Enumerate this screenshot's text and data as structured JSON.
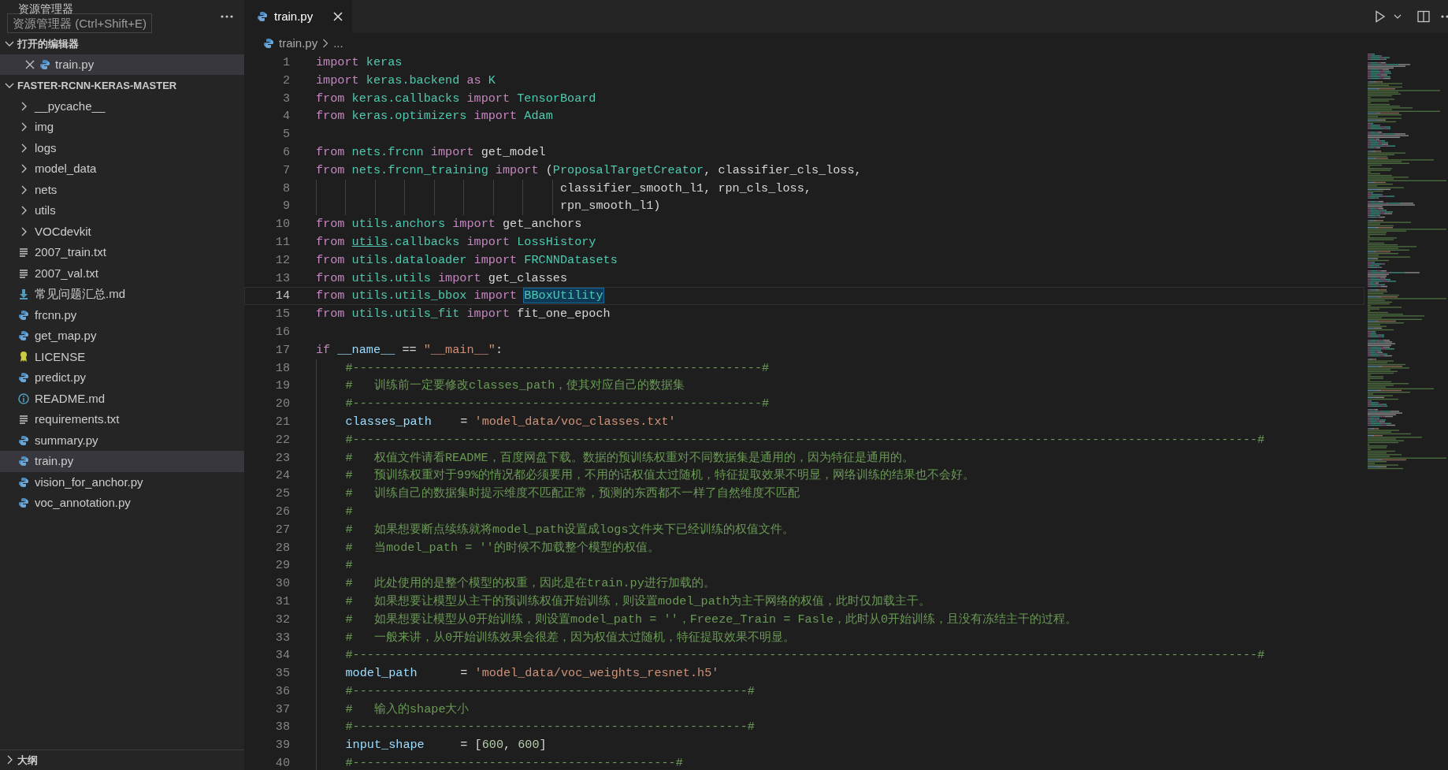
{
  "sidebar": {
    "title": "资源管理器",
    "tooltip": "资源管理器 (Ctrl+Shift+E)",
    "open_editors": {
      "label": "打开的编辑器",
      "expanded": true,
      "items": [
        {
          "name": "train.py",
          "kind": "python",
          "selected": true
        }
      ]
    },
    "project": {
      "label": "FASTER-RCNN-KERAS-MASTER",
      "expanded": true,
      "items": [
        {
          "name": "__pycache__",
          "kind": "folder",
          "selected": false
        },
        {
          "name": "img",
          "kind": "folder",
          "selected": false
        },
        {
          "name": "logs",
          "kind": "folder",
          "selected": false
        },
        {
          "name": "model_data",
          "kind": "folder",
          "selected": false
        },
        {
          "name": "nets",
          "kind": "folder",
          "selected": false
        },
        {
          "name": "utils",
          "kind": "folder",
          "selected": false
        },
        {
          "name": "VOCdevkit",
          "kind": "folder",
          "selected": false
        },
        {
          "name": "2007_train.txt",
          "kind": "text",
          "selected": false
        },
        {
          "name": "2007_val.txt",
          "kind": "text",
          "selected": false
        },
        {
          "name": "常见问题汇总.md",
          "kind": "markdown",
          "selected": false
        },
        {
          "name": "frcnn.py",
          "kind": "python",
          "selected": false
        },
        {
          "name": "get_map.py",
          "kind": "python",
          "selected": false
        },
        {
          "name": "LICENSE",
          "kind": "license",
          "selected": false
        },
        {
          "name": "predict.py",
          "kind": "python",
          "selected": false
        },
        {
          "name": "README.md",
          "kind": "info",
          "selected": false
        },
        {
          "name": "requirements.txt",
          "kind": "text",
          "selected": false
        },
        {
          "name": "summary.py",
          "kind": "python",
          "selected": false
        },
        {
          "name": "train.py",
          "kind": "python",
          "selected": true
        },
        {
          "name": "vision_for_anchor.py",
          "kind": "python",
          "selected": false
        },
        {
          "name": "voc_annotation.py",
          "kind": "python",
          "selected": false
        }
      ]
    },
    "outline": {
      "label": "大纲",
      "expanded": false
    }
  },
  "tabs": [
    {
      "label": "train.py",
      "kind": "python",
      "selected": true
    }
  ],
  "breadcrumb": [
    "train.py",
    "..."
  ],
  "editor": {
    "lines": [
      {
        "no": "1",
        "current": false,
        "tokens": [
          {
            "kind": "kw",
            "text": "import "
          },
          {
            "kind": "mod",
            "text": "keras"
          }
        ]
      },
      {
        "no": "2",
        "current": false,
        "tokens": [
          {
            "kind": "kw",
            "text": "import "
          },
          {
            "kind": "mod",
            "text": "keras.backend "
          },
          {
            "kind": "kw",
            "text": "as "
          },
          {
            "kind": "mod",
            "text": "K"
          }
        ]
      },
      {
        "no": "3",
        "current": false,
        "tokens": [
          {
            "kind": "kw",
            "text": "from "
          },
          {
            "kind": "mod",
            "text": "keras.callbacks "
          },
          {
            "kind": "kw",
            "text": "import "
          },
          {
            "kind": "mod",
            "text": "TensorBoard"
          }
        ]
      },
      {
        "no": "4",
        "current": false,
        "tokens": [
          {
            "kind": "kw",
            "text": "from "
          },
          {
            "kind": "mod",
            "text": "keras.optimizers "
          },
          {
            "kind": "kw",
            "text": "import "
          },
          {
            "kind": "mod",
            "text": "Adam"
          }
        ]
      },
      {
        "no": "5",
        "current": false
      },
      {
        "no": "6",
        "current": false,
        "tokens": [
          {
            "kind": "kw",
            "text": "from "
          },
          {
            "kind": "mod",
            "text": "nets.frcnn "
          },
          {
            "kind": "kw",
            "text": "import "
          },
          {
            "kind": "plain",
            "text": "get_model"
          }
        ]
      },
      {
        "no": "7",
        "current": false,
        "tokens": [
          {
            "kind": "kw",
            "text": "from "
          },
          {
            "kind": "mod",
            "text": "nets.frcnn_training "
          },
          {
            "kind": "kw",
            "text": "import "
          },
          {
            "kind": "plain",
            "text": "("
          },
          {
            "kind": "mod",
            "text": "ProposalTargetCreator"
          },
          {
            "kind": "plain",
            "text": ", classifier_cls_loss,"
          }
        ]
      },
      {
        "no": "8",
        "current": false,
        "tokens": [
          {
            "kind": "plain",
            "text": "                                 classifier_smooth_l1, rpn_cls_loss,"
          }
        ]
      },
      {
        "no": "9",
        "current": false,
        "tokens": [
          {
            "kind": "plain",
            "text": "                                 rpn_smooth_l1)"
          }
        ]
      },
      {
        "no": "10",
        "current": false,
        "tokens": [
          {
            "kind": "kw",
            "text": "from "
          },
          {
            "kind": "mod",
            "text": "utils.anchors "
          },
          {
            "kind": "kw",
            "text": "import "
          },
          {
            "kind": "plain",
            "text": "get_anchors"
          }
        ]
      },
      {
        "no": "11",
        "current": false,
        "tokens": [
          {
            "kind": "kw",
            "text": "from "
          },
          {
            "kind": "mod",
            "text": "utils",
            "underlined": true
          },
          {
            "kind": "mod",
            "text": ".callbacks "
          },
          {
            "kind": "kw",
            "text": "import "
          },
          {
            "kind": "mod",
            "text": "LossHistory"
          }
        ]
      },
      {
        "no": "12",
        "current": false,
        "tokens": [
          {
            "kind": "kw",
            "text": "from "
          },
          {
            "kind": "mod",
            "text": "utils.dataloader "
          },
          {
            "kind": "kw",
            "text": "import "
          },
          {
            "kind": "mod",
            "text": "FRCNNDatasets"
          }
        ]
      },
      {
        "no": "13",
        "current": false,
        "tokens": [
          {
            "kind": "kw",
            "text": "from "
          },
          {
            "kind": "mod",
            "text": "utils.utils "
          },
          {
            "kind": "kw",
            "text": "import "
          },
          {
            "kind": "plain",
            "text": "get_classes"
          }
        ]
      },
      {
        "no": "14",
        "current": true,
        "tokens": [
          {
            "kind": "kw",
            "text": "from "
          },
          {
            "kind": "mod",
            "text": "utils.utils_bbox "
          },
          {
            "kind": "kw",
            "text": "import "
          },
          {
            "kind": "mod",
            "text": "BBoxUtility",
            "highlighted": true
          }
        ]
      },
      {
        "no": "15",
        "current": false,
        "tokens": [
          {
            "kind": "kw",
            "text": "from "
          },
          {
            "kind": "mod",
            "text": "utils.utils_fit "
          },
          {
            "kind": "kw",
            "text": "import "
          },
          {
            "kind": "plain",
            "text": "fit_one_epoch"
          }
        ]
      },
      {
        "no": "16",
        "current": false
      },
      {
        "no": "17",
        "current": false,
        "tokens": [
          {
            "kind": "kw",
            "text": "if "
          },
          {
            "kind": "var",
            "text": "__name__"
          },
          {
            "kind": "plain",
            "text": " == "
          },
          {
            "kind": "str",
            "text": "\"__main__\""
          },
          {
            "kind": "plain",
            "text": ":"
          }
        ]
      },
      {
        "no": "18",
        "current": false,
        "tokens": [
          {
            "kind": "cmt",
            "text": "    #---------------------------------------------------------#"
          }
        ]
      },
      {
        "no": "19",
        "current": false,
        "tokens": [
          {
            "kind": "cmt",
            "text": "    #   训练前一定要修改classes_path，使其对应自己的数据集"
          }
        ]
      },
      {
        "no": "20",
        "current": false,
        "tokens": [
          {
            "kind": "cmt",
            "text": "    #---------------------------------------------------------#"
          }
        ]
      },
      {
        "no": "21",
        "current": false,
        "tokens": [
          {
            "kind": "var",
            "text": "    classes_path"
          },
          {
            "kind": "plain",
            "text": "    = "
          },
          {
            "kind": "str",
            "text": "'model_data/voc_classes.txt'"
          }
        ]
      },
      {
        "no": "22",
        "current": false,
        "tokens": [
          {
            "kind": "cmt",
            "text": "    #------------------------------------------------------------------------------------------------------------------------------#"
          }
        ]
      },
      {
        "no": "23",
        "current": false,
        "tokens": [
          {
            "kind": "cmt",
            "text": "    #   权值文件请看README，百度网盘下载。数据的预训练权重对不同数据集是通用的，因为特征是通用的。"
          }
        ]
      },
      {
        "no": "24",
        "current": false,
        "tokens": [
          {
            "kind": "cmt",
            "text": "    #   预训练权重对于99%的情况都必须要用，不用的话权值太过随机，特征提取效果不明显，网络训练的结果也不会好。"
          }
        ]
      },
      {
        "no": "25",
        "current": false,
        "tokens": [
          {
            "kind": "cmt",
            "text": "    #   训练自己的数据集时提示维度不匹配正常，预测的东西都不一样了自然维度不匹配"
          }
        ]
      },
      {
        "no": "26",
        "current": false,
        "tokens": [
          {
            "kind": "cmt",
            "text": "    #"
          }
        ]
      },
      {
        "no": "27",
        "current": false,
        "tokens": [
          {
            "kind": "cmt",
            "text": "    #   如果想要断点续练就将model_path设置成logs文件夹下已经训练的权值文件。"
          }
        ]
      },
      {
        "no": "28",
        "current": false,
        "tokens": [
          {
            "kind": "cmt",
            "text": "    #   当model_path = ''的时候不加载整个模型的权值。"
          }
        ]
      },
      {
        "no": "29",
        "current": false,
        "tokens": [
          {
            "kind": "cmt",
            "text": "    #"
          }
        ]
      },
      {
        "no": "30",
        "current": false,
        "tokens": [
          {
            "kind": "cmt",
            "text": "    #   此处使用的是整个模型的权重，因此是在train.py进行加载的。"
          }
        ]
      },
      {
        "no": "31",
        "current": false,
        "tokens": [
          {
            "kind": "cmt",
            "text": "    #   如果想要让模型从主干的预训练权值开始训练，则设置model_path为主干网络的权值，此时仅加载主干。"
          }
        ]
      },
      {
        "no": "32",
        "current": false,
        "tokens": [
          {
            "kind": "cmt",
            "text": "    #   如果想要让模型从0开始训练，则设置model_path = ''，Freeze_Train = Fasle，此时从0开始训练，且没有冻结主干的过程。"
          }
        ]
      },
      {
        "no": "33",
        "current": false,
        "tokens": [
          {
            "kind": "cmt",
            "text": "    #   一般来讲，从0开始训练效果会很差，因为权值太过随机，特征提取效果不明显。"
          }
        ]
      },
      {
        "no": "34",
        "current": false,
        "tokens": [
          {
            "kind": "cmt",
            "text": "    #------------------------------------------------------------------------------------------------------------------------------#"
          }
        ]
      },
      {
        "no": "35",
        "current": false,
        "tokens": [
          {
            "kind": "var",
            "text": "    model_path"
          },
          {
            "kind": "plain",
            "text": "      = "
          },
          {
            "kind": "str",
            "text": "'model_data/voc_weights_resnet.h5'"
          }
        ]
      },
      {
        "no": "36",
        "current": false,
        "tokens": [
          {
            "kind": "cmt",
            "text": "    #-------------------------------------------------------#"
          }
        ]
      },
      {
        "no": "37",
        "current": false,
        "tokens": [
          {
            "kind": "cmt",
            "text": "    #   输入的shape大小"
          }
        ]
      },
      {
        "no": "38",
        "current": false,
        "tokens": [
          {
            "kind": "cmt",
            "text": "    #-------------------------------------------------------#"
          }
        ]
      },
      {
        "no": "39",
        "current": false,
        "tokens": [
          {
            "kind": "var",
            "text": "    input_shape"
          },
          {
            "kind": "plain",
            "text": "     = ["
          },
          {
            "kind": "num",
            "text": "600"
          },
          {
            "kind": "plain",
            "text": ", "
          },
          {
            "kind": "num",
            "text": "600"
          },
          {
            "kind": "plain",
            "text": "]"
          }
        ]
      },
      {
        "no": "40",
        "current": false,
        "tokens": [
          {
            "kind": "cmt",
            "text": "    #---------------------------------------------#"
          }
        ]
      }
    ]
  }
}
